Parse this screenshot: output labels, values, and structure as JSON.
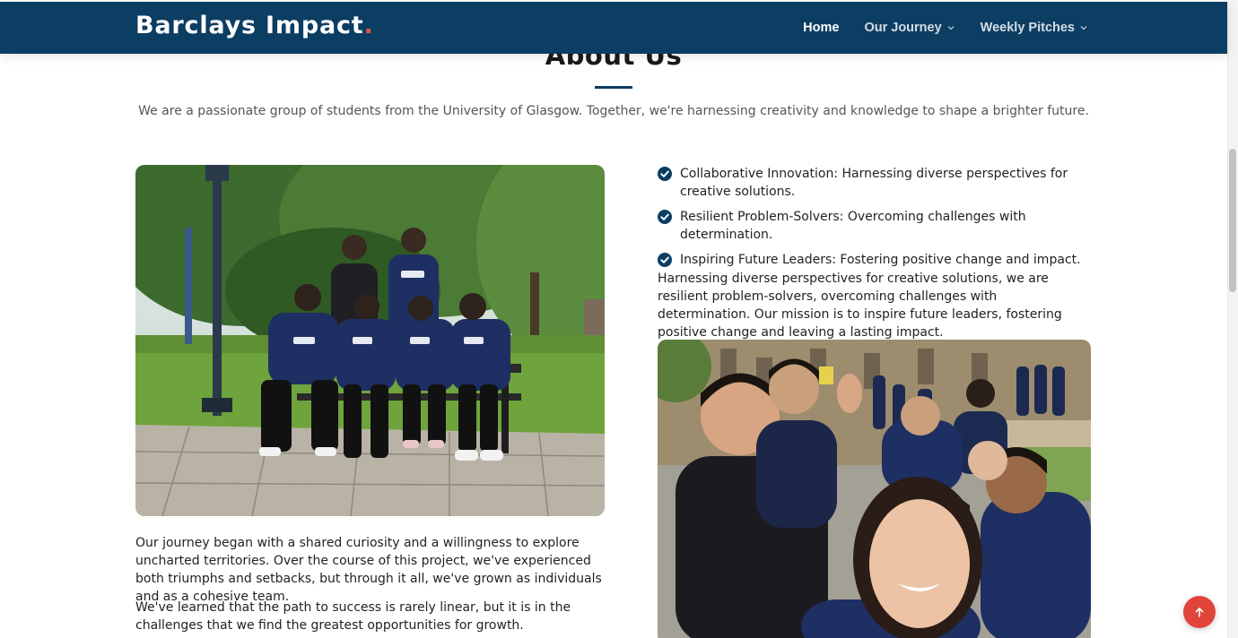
{
  "header": {
    "brand": "Barclays Impact",
    "brand_dot": ".",
    "nav": [
      {
        "label": "Home"
      },
      {
        "label": "Our Journey"
      },
      {
        "label": "Weekly Pitches"
      }
    ]
  },
  "about": {
    "title": "About Us",
    "intro": "We are a passionate group of students from the University of Glasgow. Together, we're harnessing creativity and knowledge to shape a brighter future.",
    "left_paragraphs": [
      "Our journey began with a shared curiosity and a willingness to explore uncharted territories. Over the course of this project, we've experienced both triumphs and setbacks, but through it all, we've grown as individuals and as a cohesive team.",
      "We've learned that the path to success is rarely linear, but it is in the challenges that we find the greatest opportunities for growth."
    ],
    "checklist": [
      "Collaborative Innovation: Harnessing diverse perspectives for creative solutions.",
      "Resilient Problem-Solvers: Overcoming challenges with determination.",
      "Inspiring Future Leaders: Fostering positive change and impact."
    ],
    "mission": "Harnessing diverse perspectives for creative solutions, we are resilient problem-solvers, overcoming challenges with determination. Our mission is to inspire future leaders, fostering positive change and leaving a lasting impact."
  },
  "icons": {
    "check": "check-circle-icon",
    "chevron": "chevron-down-icon",
    "to_top": "arrow-up-icon"
  },
  "colors": {
    "header_bg": "#0c3d63",
    "accent_dot": "#e0553a",
    "to_top_bg": "#e0453a"
  }
}
